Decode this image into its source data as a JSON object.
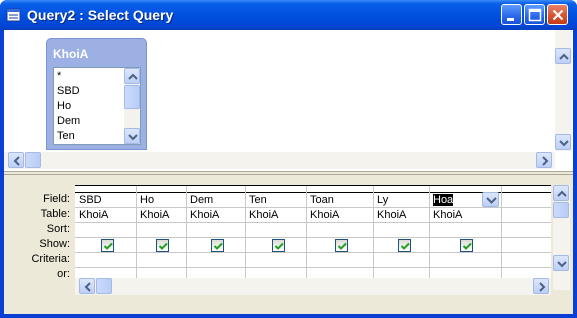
{
  "window": {
    "title": "Query2 : Select Query"
  },
  "table": {
    "name": "KhoiA",
    "fields": [
      "*",
      "SBD",
      "Ho",
      "Dem",
      "Ten"
    ]
  },
  "grid": {
    "row_labels": [
      "Field:",
      "Table:",
      "Sort:",
      "Show:",
      "Criteria:",
      "or:"
    ],
    "columns": [
      {
        "field": "SBD",
        "table": "KhoiA",
        "sort": "",
        "show": true
      },
      {
        "field": "Ho",
        "table": "KhoiA",
        "sort": "",
        "show": true
      },
      {
        "field": "Dem",
        "table": "KhoiA",
        "sort": "",
        "show": true
      },
      {
        "field": "Ten",
        "table": "KhoiA",
        "sort": "",
        "show": true
      },
      {
        "field": "Toan",
        "table": "KhoiA",
        "sort": "",
        "show": true
      },
      {
        "field": "Ly",
        "table": "KhoiA",
        "sort": "",
        "show": true
      },
      {
        "field": "Hoa",
        "table": "KhoiA",
        "sort": "",
        "show": true,
        "selected": true
      }
    ]
  },
  "icons": {
    "title": "query-icon",
    "minimize": "minimize-icon",
    "maximize": "maximize-icon",
    "close": "close-icon",
    "dropdown": "chevron-down-icon",
    "check": "checkmark-icon"
  }
}
